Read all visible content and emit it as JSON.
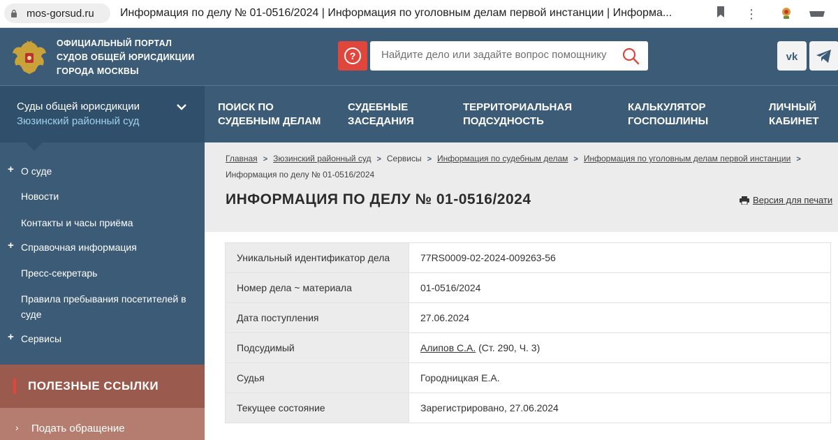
{
  "browser": {
    "url": "mos-gorsud.ru",
    "tab_title": "Информация по делу № 01-0516/2024 | Информация по уголовным делам первой инстанции | Информа..."
  },
  "header": {
    "portal_title_lines": [
      "ОФИЦИАЛЬНЫЙ ПОРТАЛ",
      "СУДОВ ОБЩЕЙ ЮРИСДИКЦИИ",
      "ГОРОДА МОСКВЫ"
    ],
    "help_label": "?",
    "search_placeholder": "Найдите дело или задайте вопрос помощнику",
    "social": [
      "vk-icon",
      "telegram-icon"
    ]
  },
  "nav": {
    "court_selector": {
      "title": "Суды общей юрисдикции",
      "subtitle": "Зюзинский районный суд"
    },
    "items": [
      {
        "line1": "ПОИСК ПО",
        "line2": "СУДЕБНЫМ ДЕЛАМ"
      },
      {
        "line1": "СУДЕБНЫЕ",
        "line2": "ЗАСЕДАНИЯ"
      },
      {
        "line1": "ТЕРРИТОРИАЛЬНАЯ",
        "line2": "ПОДСУДНОСТЬ"
      },
      {
        "line1": "КАЛЬКУЛЯТОР",
        "line2": "ГОСПОШЛИНЫ"
      },
      {
        "line1": "ЛИЧНЫЙ",
        "line2": "КАБИНЕТ"
      }
    ]
  },
  "sidebar": {
    "items": [
      {
        "label": "О суде",
        "expandable": true
      },
      {
        "label": "Новости",
        "expandable": false
      },
      {
        "label": "Контакты и часы приёма",
        "expandable": false
      },
      {
        "label": "Справочная информация",
        "expandable": true
      },
      {
        "label": "Пресс-секретарь",
        "expandable": false
      },
      {
        "label": "Правила пребывания посетителей в суде",
        "expandable": false
      },
      {
        "label": "Сервисы",
        "expandable": true
      }
    ],
    "useful_links_title": "ПОЛЕЗНЫЕ ССЫЛКИ",
    "useful_links": [
      "Подать обращение"
    ]
  },
  "breadcrumbs": [
    "Главная",
    "Зюзинский районный суд",
    "Сервисы",
    "Информация по судебным делам",
    "Информация по уголовным делам первой инстанции",
    "Информация по делу № 01-0516/2024"
  ],
  "page": {
    "title": "ИНФОРМАЦИЯ ПО ДЕЛУ № 01-0516/2024",
    "print_label": "Версия для печати"
  },
  "case_info": {
    "rows": [
      {
        "label": "Уникальный идентификатор дела",
        "value": "77RS0009-02-2024-009263-56"
      },
      {
        "label": "Номер дела ~ материала",
        "value": "01-0516/2024"
      },
      {
        "label": "Дата поступления",
        "value": "27.06.2024"
      },
      {
        "label": "Подсудимый",
        "value_link": "Алипов С.А.",
        "value_suffix": "(Ст. 290, Ч. 3)"
      },
      {
        "label": "Судья",
        "value": "Городницкая Е.А."
      },
      {
        "label": "Текущее состояние",
        "value": "Зарегистрировано, 27.06.2024"
      }
    ]
  },
  "colors": {
    "header_bg": "#3b5b76",
    "selector_bg": "#2f4f6a",
    "accent_red": "#e0473c",
    "useful_bg": "#9a5a4d",
    "content_bg": "#ececec"
  }
}
